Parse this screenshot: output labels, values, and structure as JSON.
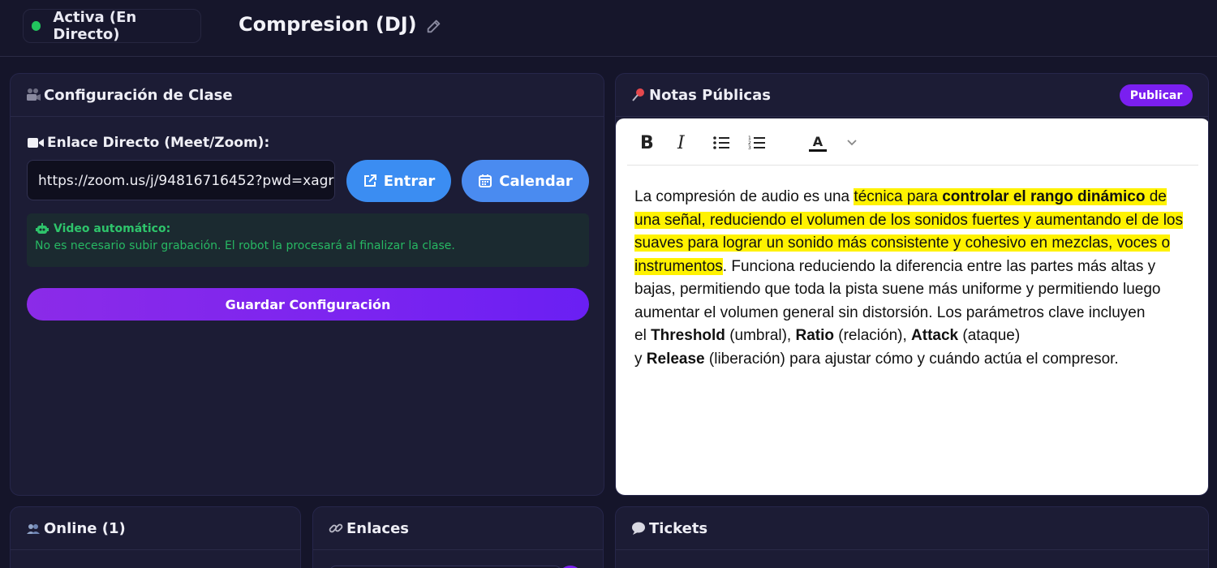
{
  "header": {
    "status": "Activa (En Directo)",
    "title": "Compresion (DJ)"
  },
  "config": {
    "title": "Configuración de Clase",
    "link_label": "Enlace Directo (Meet/Zoom):",
    "link_value": "https://zoom.us/j/94816716452?pwd=xagr",
    "enter_label": "Entrar",
    "calendar_label": "Calendar",
    "video_title": "Video automático:",
    "video_desc": "No es necesario subir grabación. El robot la procesará al finalizar la clase.",
    "save_label": "Guardar Configuración"
  },
  "notes": {
    "title": "Notas Públicas",
    "publish_label": "Publicar",
    "toolbar": {
      "bold": "B",
      "italic": "I",
      "color": "A"
    },
    "content": {
      "p1": "La compresión de audio es una ",
      "h1": "técnica para ",
      "h1b": "controlar el rango dinámico",
      "h2": " de una señal, reduciendo el volumen de los sonidos fuertes y aumentando el de los suaves para lograr un sonido más consistente y cohesivo en mezclas, voces o instrumentos",
      "p2": ". Funciona reduciendo la diferencia entre las partes más altas y bajas, permitiendo que toda la pista suene más uniforme y permitiendo luego aumentar el volumen general sin distorsión. Los parámetros clave incluyen",
      "l2a": "el ",
      "threshold": "Threshold",
      "l2b": " (umbral), ",
      "ratio": "Ratio",
      "l2c": " (relación), ",
      "attack": "Attack",
      "l2d": " (ataque)",
      "l3a": "y ",
      "release": "Release",
      "l3b": " (liberación) para ajustar cómo y cuándo actúa el compresor."
    }
  },
  "online": {
    "title": "Online (1)"
  },
  "links": {
    "title": "Enlaces"
  },
  "tickets": {
    "title": "Tickets"
  },
  "colors": {
    "accent_purple": "#7a1ff0",
    "accent_blue": "#3b8df2",
    "status_green": "#22c55e",
    "highlight": "#fff200"
  },
  "icons": {
    "status": "live-dot-icon",
    "edit": "pencil-icon",
    "config": "film-camera-icon",
    "link": "video-camera-icon",
    "enter": "external-link-icon",
    "calendar": "calendar-icon",
    "video": "robot-icon",
    "notes": "pushpin-icon",
    "online": "users-icon",
    "links": "link-chain-icon",
    "tickets": "speech-bubble-icon"
  }
}
